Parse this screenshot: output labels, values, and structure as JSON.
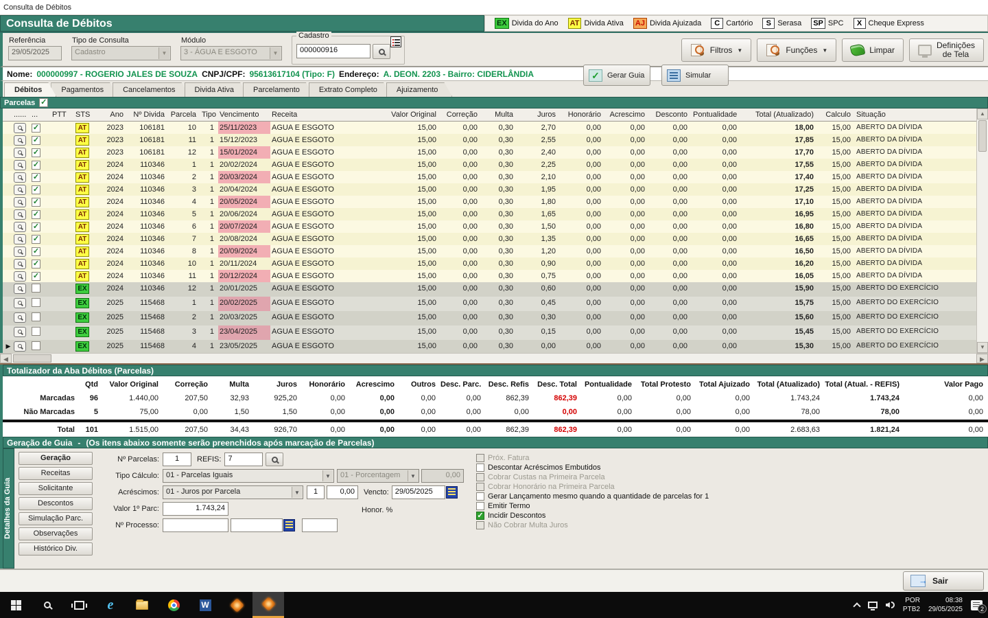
{
  "window": {
    "title": "Consulta de Débitos"
  },
  "header": {
    "title": "Consulta de Débitos",
    "legend": [
      {
        "code": "EX",
        "label": "Divida do Ano",
        "bg": "#3ECC3E",
        "border": "#0E720E",
        "color": "#00320A"
      },
      {
        "code": "AT",
        "label": "Divida Ativa",
        "bg": "#FFFF45",
        "border": "#8F8F00",
        "color": "#7A2A00"
      },
      {
        "code": "AJ",
        "label": "Divida Ajuizada",
        "bg": "#F5A957",
        "border": "#B04000",
        "color": "#CC1100"
      },
      {
        "code": "C",
        "label": "Cartório",
        "bg": "#FFFFFF",
        "border": "#444444",
        "color": "#000000"
      },
      {
        "code": "S",
        "label": "Serasa",
        "bg": "#FFFFFF",
        "border": "#444444",
        "color": "#000000"
      },
      {
        "code": "SP",
        "label": "SPC",
        "bg": "#FFFFFF",
        "border": "#444444",
        "color": "#000000"
      },
      {
        "code": "X",
        "label": "Cheque Express",
        "bg": "#FFFFFF",
        "border": "#444444",
        "color": "#000000"
      }
    ]
  },
  "filters": {
    "referencia_label": "Referência",
    "referencia_value": "29/05/2025",
    "tipo_label": "Tipo de Consulta",
    "tipo_value": "Cadastro",
    "modulo_label": "Módulo",
    "modulo_value": "3 - ÁGUA E ESGOTO",
    "cadastro_label": "Cadastro",
    "cadastro_value": "000000916"
  },
  "toolbar": {
    "filtros": "Filtros",
    "funcoes": "Funções",
    "limpar": "Limpar",
    "definicoes_1": "Definições",
    "definicoes_2": "de Tela"
  },
  "identity": {
    "nome_label": "Nome:",
    "nome": "000000997 - ROGERIO JALES DE SOUZA",
    "cnpj_label": "CNPJ/CPF:",
    "cnpj": "95613617104 (Tipo: F)",
    "endereco_label": "Endereço:",
    "endereco": "A. DEON. 2203 - Bairro: CIDERLÂNDIA"
  },
  "tabs": [
    "Débitos",
    "Pagamentos",
    "Cancelamentos",
    "Divida Ativa",
    "Parcelamento",
    "Extrato Completo",
    "Ajuizamento"
  ],
  "parcelas_label": "Parcelas",
  "grid": {
    "headers": [
      "",
      "......",
      "...",
      "PTT",
      "STS",
      "Ano",
      "Nº Divida",
      "Parcela",
      "Tipo",
      "Vencimento",
      "Receita",
      "Valor Original",
      "Correção",
      "Multa",
      "Juros",
      "Honorário",
      "Acrescimo",
      "Desconto",
      "Pontualidade",
      "Total (Atualizado)",
      "Calculo",
      "Situação"
    ],
    "rows": [
      {
        "kind": "AT",
        "checked": true,
        "sts": "AT",
        "ano": "2023",
        "divida": "106181",
        "parcela": "10",
        "tipo": "1",
        "venc": "25/11/2023",
        "receita": "AGUA E ESGOTO",
        "valor": "15,00",
        "correcao": "0,00",
        "multa": "0,30",
        "juros": "2,70",
        "honorario": "0,00",
        "acrescimo": "0,00",
        "desconto": "0,00",
        "pontualidade": "0,00",
        "total": "18,00",
        "calculo": "15,00",
        "situacao": "ABERTO DA DÍVIDA",
        "current": false
      },
      {
        "kind": "AT",
        "checked": true,
        "sts": "AT",
        "ano": "2023",
        "divida": "106181",
        "parcela": "11",
        "tipo": "1",
        "venc": "15/12/2023",
        "receita": "AGUA E ESGOTO",
        "valor": "15,00",
        "correcao": "0,00",
        "multa": "0,30",
        "juros": "2,55",
        "honorario": "0,00",
        "acrescimo": "0,00",
        "desconto": "0,00",
        "pontualidade": "0,00",
        "total": "17,85",
        "calculo": "15,00",
        "situacao": "ABERTO DA DÍVIDA",
        "current": false
      },
      {
        "kind": "AT",
        "checked": true,
        "sts": "AT",
        "ano": "2023",
        "divida": "106181",
        "parcela": "12",
        "tipo": "1",
        "venc": "15/01/2024",
        "receita": "AGUA E ESGOTO",
        "valor": "15,00",
        "correcao": "0,00",
        "multa": "0,30",
        "juros": "2,40",
        "honorario": "0,00",
        "acrescimo": "0,00",
        "desconto": "0,00",
        "pontualidade": "0,00",
        "total": "17,70",
        "calculo": "15,00",
        "situacao": "ABERTO DA DÍVIDA",
        "current": false
      },
      {
        "kind": "AT",
        "checked": true,
        "sts": "AT",
        "ano": "2024",
        "divida": "110346",
        "parcela": "1",
        "tipo": "1",
        "venc": "20/02/2024",
        "receita": "AGUA E ESGOTO",
        "valor": "15,00",
        "correcao": "0,00",
        "multa": "0,30",
        "juros": "2,25",
        "honorario": "0,00",
        "acrescimo": "0,00",
        "desconto": "0,00",
        "pontualidade": "0,00",
        "total": "17,55",
        "calculo": "15,00",
        "situacao": "ABERTO DA DÍVIDA",
        "current": false
      },
      {
        "kind": "AT",
        "checked": true,
        "sts": "AT",
        "ano": "2024",
        "divida": "110346",
        "parcela": "2",
        "tipo": "1",
        "venc": "20/03/2024",
        "receita": "AGUA E ESGOTO",
        "valor": "15,00",
        "correcao": "0,00",
        "multa": "0,30",
        "juros": "2,10",
        "honorario": "0,00",
        "acrescimo": "0,00",
        "desconto": "0,00",
        "pontualidade": "0,00",
        "total": "17,40",
        "calculo": "15,00",
        "situacao": "ABERTO DA DÍVIDA",
        "current": false
      },
      {
        "kind": "AT",
        "checked": true,
        "sts": "AT",
        "ano": "2024",
        "divida": "110346",
        "parcela": "3",
        "tipo": "1",
        "venc": "20/04/2024",
        "receita": "AGUA E ESGOTO",
        "valor": "15,00",
        "correcao": "0,00",
        "multa": "0,30",
        "juros": "1,95",
        "honorario": "0,00",
        "acrescimo": "0,00",
        "desconto": "0,00",
        "pontualidade": "0,00",
        "total": "17,25",
        "calculo": "15,00",
        "situacao": "ABERTO DA DÍVIDA",
        "current": false
      },
      {
        "kind": "AT",
        "checked": true,
        "sts": "AT",
        "ano": "2024",
        "divida": "110346",
        "parcela": "4",
        "tipo": "1",
        "venc": "20/05/2024",
        "receita": "AGUA E ESGOTO",
        "valor": "15,00",
        "correcao": "0,00",
        "multa": "0,30",
        "juros": "1,80",
        "honorario": "0,00",
        "acrescimo": "0,00",
        "desconto": "0,00",
        "pontualidade": "0,00",
        "total": "17,10",
        "calculo": "15,00",
        "situacao": "ABERTO DA DÍVIDA",
        "current": false
      },
      {
        "kind": "AT",
        "checked": true,
        "sts": "AT",
        "ano": "2024",
        "divida": "110346",
        "parcela": "5",
        "tipo": "1",
        "venc": "20/06/2024",
        "receita": "AGUA E ESGOTO",
        "valor": "15,00",
        "correcao": "0,00",
        "multa": "0,30",
        "juros": "1,65",
        "honorario": "0,00",
        "acrescimo": "0,00",
        "desconto": "0,00",
        "pontualidade": "0,00",
        "total": "16,95",
        "calculo": "15,00",
        "situacao": "ABERTO DA DÍVIDA",
        "current": false
      },
      {
        "kind": "AT",
        "checked": true,
        "sts": "AT",
        "ano": "2024",
        "divida": "110346",
        "parcela": "6",
        "tipo": "1",
        "venc": "20/07/2024",
        "receita": "AGUA E ESGOTO",
        "valor": "15,00",
        "correcao": "0,00",
        "multa": "0,30",
        "juros": "1,50",
        "honorario": "0,00",
        "acrescimo": "0,00",
        "desconto": "0,00",
        "pontualidade": "0,00",
        "total": "16,80",
        "calculo": "15,00",
        "situacao": "ABERTO DA DÍVIDA",
        "current": false
      },
      {
        "kind": "AT",
        "checked": true,
        "sts": "AT",
        "ano": "2024",
        "divida": "110346",
        "parcela": "7",
        "tipo": "1",
        "venc": "20/08/2024",
        "receita": "AGUA E ESGOTO",
        "valor": "15,00",
        "correcao": "0,00",
        "multa": "0,30",
        "juros": "1,35",
        "honorario": "0,00",
        "acrescimo": "0,00",
        "desconto": "0,00",
        "pontualidade": "0,00",
        "total": "16,65",
        "calculo": "15,00",
        "situacao": "ABERTO DA DÍVIDA",
        "current": false
      },
      {
        "kind": "AT",
        "checked": true,
        "sts": "AT",
        "ano": "2024",
        "divida": "110346",
        "parcela": "8",
        "tipo": "1",
        "venc": "20/09/2024",
        "receita": "AGUA E ESGOTO",
        "valor": "15,00",
        "correcao": "0,00",
        "multa": "0,30",
        "juros": "1,20",
        "honorario": "0,00",
        "acrescimo": "0,00",
        "desconto": "0,00",
        "pontualidade": "0,00",
        "total": "16,50",
        "calculo": "15,00",
        "situacao": "ABERTO DA DÍVIDA",
        "current": false
      },
      {
        "kind": "AT",
        "checked": true,
        "sts": "AT",
        "ano": "2024",
        "divida": "110346",
        "parcela": "10",
        "tipo": "1",
        "venc": "20/11/2024",
        "receita": "AGUA E ESGOTO",
        "valor": "15,00",
        "correcao": "0,00",
        "multa": "0,30",
        "juros": "0,90",
        "honorario": "0,00",
        "acrescimo": "0,00",
        "desconto": "0,00",
        "pontualidade": "0,00",
        "total": "16,20",
        "calculo": "15,00",
        "situacao": "ABERTO DA DÍVIDA",
        "current": false
      },
      {
        "kind": "AT",
        "checked": true,
        "sts": "AT",
        "ano": "2024",
        "divida": "110346",
        "parcela": "11",
        "tipo": "1",
        "venc": "20/12/2024",
        "receita": "AGUA E ESGOTO",
        "valor": "15,00",
        "correcao": "0,00",
        "multa": "0,30",
        "juros": "0,75",
        "honorario": "0,00",
        "acrescimo": "0,00",
        "desconto": "0,00",
        "pontualidade": "0,00",
        "total": "16,05",
        "calculo": "15,00",
        "situacao": "ABERTO DA DÍVIDA",
        "current": false
      },
      {
        "kind": "EX",
        "checked": false,
        "sts": "EX",
        "ano": "2024",
        "divida": "110346",
        "parcela": "12",
        "tipo": "1",
        "venc": "20/01/2025",
        "receita": "AGUA E ESGOTO",
        "valor": "15,00",
        "correcao": "0,00",
        "multa": "0,30",
        "juros": "0,60",
        "honorario": "0,00",
        "acrescimo": "0,00",
        "desconto": "0,00",
        "pontualidade": "0,00",
        "total": "15,90",
        "calculo": "15,00",
        "situacao": "ABERTO DO EXERCÍCIO",
        "current": false
      },
      {
        "kind": "EX",
        "checked": false,
        "sts": "EX",
        "ano": "2025",
        "divida": "115468",
        "parcela": "1",
        "tipo": "1",
        "venc": "20/02/2025",
        "receita": "AGUA E ESGOTO",
        "valor": "15,00",
        "correcao": "0,00",
        "multa": "0,30",
        "juros": "0,45",
        "honorario": "0,00",
        "acrescimo": "0,00",
        "desconto": "0,00",
        "pontualidade": "0,00",
        "total": "15,75",
        "calculo": "15,00",
        "situacao": "ABERTO DO EXERCÍCIO",
        "current": false
      },
      {
        "kind": "EX",
        "checked": false,
        "sts": "EX",
        "ano": "2025",
        "divida": "115468",
        "parcela": "2",
        "tipo": "1",
        "venc": "20/03/2025",
        "receita": "AGUA E ESGOTO",
        "valor": "15,00",
        "correcao": "0,00",
        "multa": "0,30",
        "juros": "0,30",
        "honorario": "0,00",
        "acrescimo": "0,00",
        "desconto": "0,00",
        "pontualidade": "0,00",
        "total": "15,60",
        "calculo": "15,00",
        "situacao": "ABERTO DO EXERCÍCIO",
        "current": false
      },
      {
        "kind": "EX",
        "checked": false,
        "sts": "EX",
        "ano": "2025",
        "divida": "115468",
        "parcela": "3",
        "tipo": "1",
        "venc": "23/04/2025",
        "receita": "AGUA E ESGOTO",
        "valor": "15,00",
        "correcao": "0,00",
        "multa": "0,30",
        "juros": "0,15",
        "honorario": "0,00",
        "acrescimo": "0,00",
        "desconto": "0,00",
        "pontualidade": "0,00",
        "total": "15,45",
        "calculo": "15,00",
        "situacao": "ABERTO DO EXERCÍCIO",
        "current": false
      },
      {
        "kind": "EX",
        "checked": false,
        "sts": "EX",
        "ano": "2025",
        "divida": "115468",
        "parcela": "4",
        "tipo": "1",
        "venc": "23/05/2025",
        "receita": "AGUA E ESGOTO",
        "valor": "15,00",
        "correcao": "0,00",
        "multa": "0,30",
        "juros": "0,00",
        "honorario": "0,00",
        "acrescimo": "0,00",
        "desconto": "0,00",
        "pontualidade": "0,00",
        "total": "15,30",
        "calculo": "15,00",
        "situacao": "ABERTO DO EXERCÍCIO",
        "current": true
      }
    ]
  },
  "totalizer": {
    "title": "Totalizador da Aba Débitos (Parcelas)",
    "headers": [
      "Qtd",
      "Valor Original",
      "Correção",
      "Multa",
      "Juros",
      "Honorário",
      "Acrescimo",
      "Outros",
      "Desc. Parc.",
      "Desc. Refis",
      "Desc. Total",
      "Pontualidade",
      "Total Protesto",
      "Total Ajuizado",
      "Total (Atualizado)",
      "Total (Atual. - REFIS)",
      "Valor Pago"
    ],
    "rows": [
      {
        "label": "Marcadas",
        "is_total": false,
        "values": [
          "96",
          "1.440,00",
          "207,50",
          "32,93",
          "925,20",
          "0,00",
          "0,00",
          "0,00",
          "0,00",
          "862,39",
          "862,39",
          "0,00",
          "0,00",
          "0,00",
          "1.743,24",
          "1.743,24",
          "0,00"
        ]
      },
      {
        "label": "Não Marcadas",
        "is_total": false,
        "values": [
          "5",
          "75,00",
          "0,00",
          "1,50",
          "1,50",
          "0,00",
          "0,00",
          "0,00",
          "0,00",
          "0,00",
          "0,00",
          "0,00",
          "0,00",
          "0,00",
          "78,00",
          "78,00",
          "0,00"
        ]
      },
      {
        "label": "Total",
        "is_total": true,
        "values": [
          "101",
          "1.515,00",
          "207,50",
          "34,43",
          "926,70",
          "0,00",
          "0,00",
          "0,00",
          "0,00",
          "862,39",
          "862,39",
          "0,00",
          "0,00",
          "0,00",
          "2.683,63",
          "1.821,24",
          "0,00"
        ]
      }
    ]
  },
  "guia": {
    "title": "Geração de Guia",
    "sep": "-",
    "note": "(Os itens abaixo somente serão preenchidos após marcação de Parcelas)",
    "vertical_tab": "Detalhes da Guia",
    "side_buttons": [
      "Geração",
      "Receitas",
      "Solicitante",
      "Descontos",
      "Simulação Parc.",
      "Observações",
      "Histórico Div."
    ],
    "fields": {
      "n_parcelas_label": "Nº Parcelas:",
      "n_parcelas_value": "1",
      "refis_label": "REFIS:",
      "refis_value": "7",
      "tipo_calculo_label": "Tipo Cálculo:",
      "tipo_calculo_value": "01 - Parcelas Iguais",
      "porcentagem_value": "01 - Porcentagem",
      "porcentagem_num": "0,00",
      "acrescimos_label": "Acréscimos:",
      "acrescimos_value": "01 - Juros por Parcela",
      "acrescimos_qtd": "1",
      "acrescimos_num": "0,00",
      "vencto_label": "Vencto:",
      "vencto_value": "29/05/2025",
      "valor_parc_label": "Valor 1º Parc:",
      "valor_parc_value": "1.743,24",
      "honor_label": "Honor. %",
      "processo_label": "Nº Processo:"
    },
    "checkboxes": [
      {
        "label": "Próx. Fatura",
        "checked": false,
        "disabled": true
      },
      {
        "label": "Descontar Acréscimos Embutidos",
        "checked": false,
        "disabled": false
      },
      {
        "label": "Cobrar Custas na Primeira Parcela",
        "checked": false,
        "disabled": true
      },
      {
        "label": "Cobrar Honorário na Primeira Parcela",
        "checked": false,
        "disabled": true
      },
      {
        "label": "Gerar Lançamento mesmo quando a quantidade de parcelas for 1",
        "checked": false,
        "disabled": false
      },
      {
        "label": "Emitir Termo",
        "checked": false,
        "disabled": false
      },
      {
        "label": "Incidir Descontos",
        "checked": true,
        "disabled": false
      },
      {
        "label": "Não Cobrar Multa Juros",
        "checked": false,
        "disabled": true
      }
    ],
    "gerar_guia": "Gerar Guia",
    "simular": "Simular"
  },
  "footer": {
    "sair": "Sair"
  },
  "taskbar": {
    "lang_top": "POR",
    "lang_bottom": "PTB2",
    "time": "08:38",
    "date": "29/05/2025",
    "badge": "2"
  }
}
